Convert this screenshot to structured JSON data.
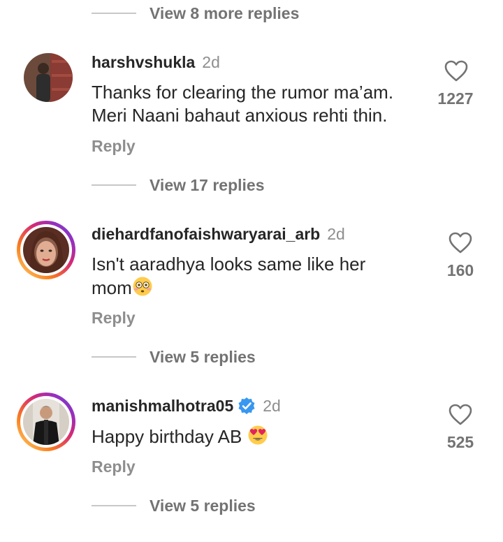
{
  "thread0": {
    "view_replies": "View 8 more replies"
  },
  "comments": [
    {
      "username": "harshvshukla",
      "time": "2d",
      "text_line1": "Thanks for clearing the rumor ma’am.",
      "text_line2": "Meri Naani bahaut anxious rehti thin.",
      "reply_label": "Reply",
      "likes": "1227",
      "view_replies": "View 17 replies",
      "has_story_ring": false
    },
    {
      "username": "diehardfanofaishwaryarai_arb",
      "time": "2d",
      "text_line1": "Isn't aaradhya looks same like her",
      "text_line2": "mom",
      "emoji": "flushed-face-emoji",
      "reply_label": "Reply",
      "likes": "160",
      "view_replies": "View 5 replies",
      "has_story_ring": true
    },
    {
      "username": "manishmalhotra05",
      "verified": true,
      "time": "2d",
      "text_line1": "Happy birthday AB",
      "emoji": "heart-eyes-emoji",
      "reply_label": "Reply",
      "likes": "525",
      "view_replies": "View 5 replies",
      "has_story_ring": true
    }
  ],
  "icons": {
    "like": "heart-outline-icon",
    "verified": "verified-badge-icon"
  },
  "colors": {
    "verified_blue": "#3897f0",
    "secondary_text": "#8e8e8e",
    "primary_text": "#262626"
  }
}
